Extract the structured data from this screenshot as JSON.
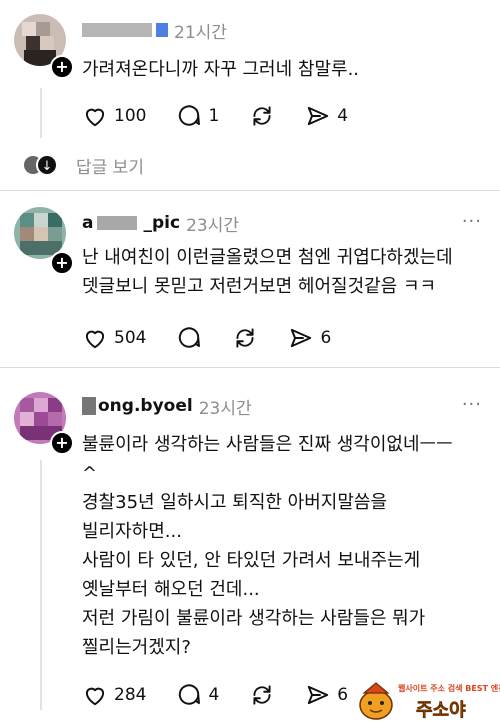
{
  "posts": [
    {
      "username": "",
      "time": "21시간",
      "lines": [
        "가려져온다니까 자꾸 그러네 참말루.."
      ],
      "likes": "100",
      "comments": "1",
      "reposts": "",
      "shares": "4"
    },
    {
      "username": "a",
      "username_suffix": "_pic",
      "time": "23시간",
      "lines": [
        "난 내여친이 이런글올렸으면 첨엔 귀엽다하겠는데",
        "뎃글보니 못믿고 저런거보면 헤어질것같음 ㅋㅋ"
      ],
      "likes": "504",
      "comments": "",
      "reposts": "",
      "shares": "6"
    },
    {
      "username": "ong.byoel",
      "time": "23시간",
      "lines": [
        "불륜이라 생각하는 사람들은 진짜 생각이없네ㅡㅡ",
        "^",
        "경찰35년 일하시고 퇴직한 아버지말씀을",
        "빌리자하면...",
        "사람이 타 있던, 안 타있던 가려서 보내주는게",
        "옛날부터 해오던 건데...",
        "저런 가림이 불륜이라 생각하는 사람들은 뭐가",
        "찔리는거겠지?"
      ],
      "likes": "284",
      "comments": "4",
      "reposts": "",
      "shares": "6"
    }
  ],
  "replies_label": "답글 보기",
  "more_label": "···",
  "watermark": {
    "top": "웹사이트 주소 검색 BEST 엔진",
    "main": "주소야"
  },
  "icons": [
    "heart-icon",
    "comment-icon",
    "repost-icon",
    "share-icon",
    "more-icon",
    "plus-icon",
    "chevron-down-icon"
  ]
}
